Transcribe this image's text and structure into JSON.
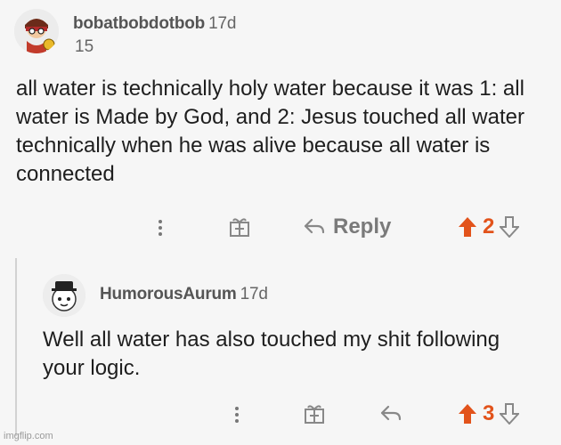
{
  "comments": [
    {
      "username": "bobatbobdotbob",
      "time": "17d",
      "flair": "15",
      "body": "all water is technically holy water because it was 1: all water is Made by God, and 2: Jesus touched all water technically when he was alive because all water is connected",
      "actions": {
        "reply_label": "Reply",
        "score": "2"
      }
    },
    {
      "username": "HumorousAurum",
      "time": "17d",
      "body": "Well all water has also touched my shit following your logic.",
      "actions": {
        "score": "3"
      }
    }
  ],
  "watermark": "imgflip.com",
  "colors": {
    "upvote": "#e2531b",
    "text": "#1e1e1e",
    "muted": "#888888"
  },
  "icons": [
    "more-options-icon",
    "award-icon",
    "reply-arrow-icon",
    "upvote-arrow-icon",
    "downvote-arrow-icon"
  ]
}
